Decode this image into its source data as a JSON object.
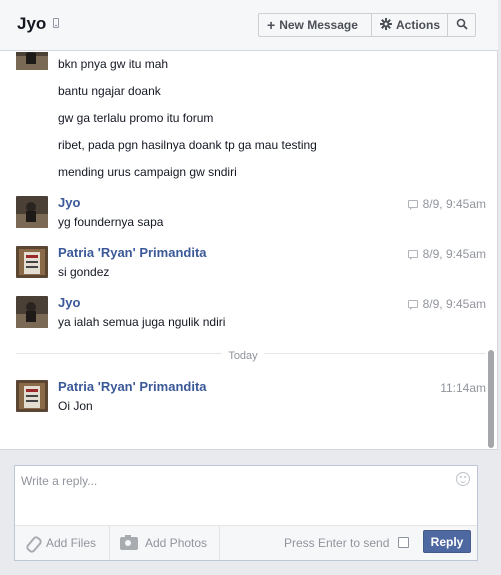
{
  "header": {
    "title": "Jyo",
    "new_message_label": "New Message",
    "actions_label": "Actions"
  },
  "messages": [
    {
      "text": "bkn pnya gw itu mah"
    },
    {
      "text": "bantu ngajar doank"
    },
    {
      "text": "gw ga terlalu promo itu forum"
    },
    {
      "text": "ribet, pada pgn hasilnya doank tp ga mau testing"
    },
    {
      "text": "mending urus campaign gw sndiri"
    },
    {
      "sender": "Jyo",
      "timestamp": "8/9, 9:45am",
      "text": "yg foundernya sapa"
    },
    {
      "sender": "Patria 'Ryan' Primandita",
      "timestamp": "8/9, 9:45am",
      "text": "si gondez"
    },
    {
      "sender": "Jyo",
      "timestamp": "8/9, 9:45am",
      "text": "ya ialah semua juga ngulik ndiri"
    },
    {
      "sender": "Patria 'Ryan' Primandita",
      "timestamp": "11:14am",
      "text": "Oi Jon"
    }
  ],
  "divider_label": "Today",
  "composer": {
    "placeholder": "Write a reply...",
    "add_files_label": "Add Files",
    "add_photos_label": "Add Photos",
    "enter_to_send_label": "Press Enter to send",
    "enter_to_send_checked": false,
    "reply_label": "Reply"
  },
  "colors": {
    "link_blue": "#3b5998",
    "reply_button": "#4e69a2"
  }
}
